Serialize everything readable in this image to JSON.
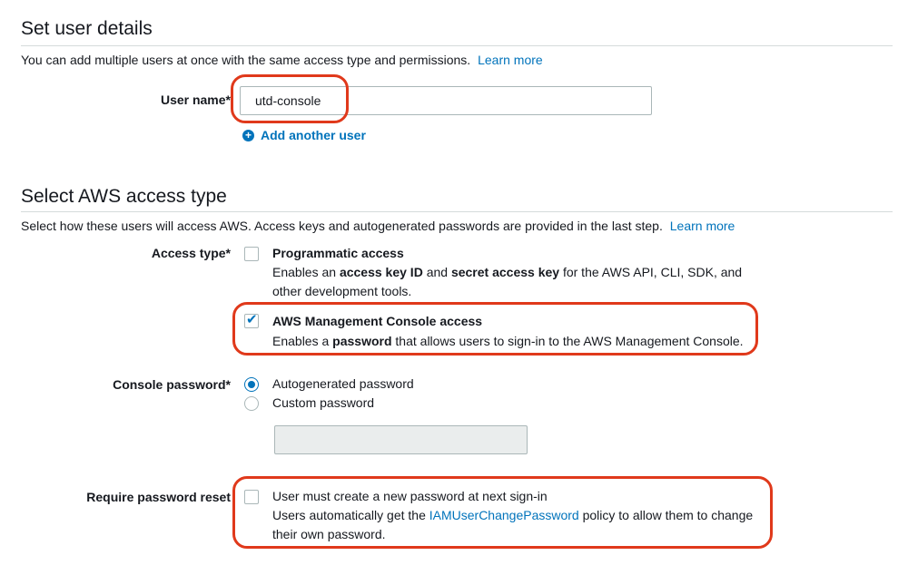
{
  "user_details": {
    "heading": "Set user details",
    "description": "You can add multiple users at once with the same access type and permissions.",
    "learn_more": "Learn more",
    "user_name_label": "User name*",
    "user_name_value": "utd-console",
    "add_another_user": "Add another user"
  },
  "access_type": {
    "heading": "Select AWS access type",
    "description": "Select how these users will access AWS. Access keys and autogenerated passwords are provided in the last step.",
    "learn_more": "Learn more",
    "access_type_label": "Access type*",
    "programmatic": {
      "title": "Programmatic access",
      "checked": false,
      "desc_1": "Enables an ",
      "desc_b1": "access key ID",
      "desc_2": " and ",
      "desc_b2": "secret access key",
      "desc_3": " for the AWS API, CLI, SDK, and other development tools."
    },
    "console": {
      "title": "AWS Management Console access",
      "checked": true,
      "desc_1": "Enables a ",
      "desc_b1": "password",
      "desc_2": " that allows users to sign-in to the AWS Management Console."
    }
  },
  "console_password": {
    "label": "Console password*",
    "options": [
      "Autogenerated password",
      "Custom password"
    ],
    "selected": "Autogenerated password",
    "custom_value": ""
  },
  "password_reset": {
    "label": "Require password reset",
    "checked": false,
    "title": "User must create a new password at next sign-in",
    "desc_1": "Users automatically get the ",
    "policy_link": "IAMUserChangePassword",
    "desc_2": " policy to allow them to change their own password."
  },
  "colors": {
    "link": "#0073bb",
    "highlight": "#e0391b",
    "rule": "#d5dbdb"
  }
}
